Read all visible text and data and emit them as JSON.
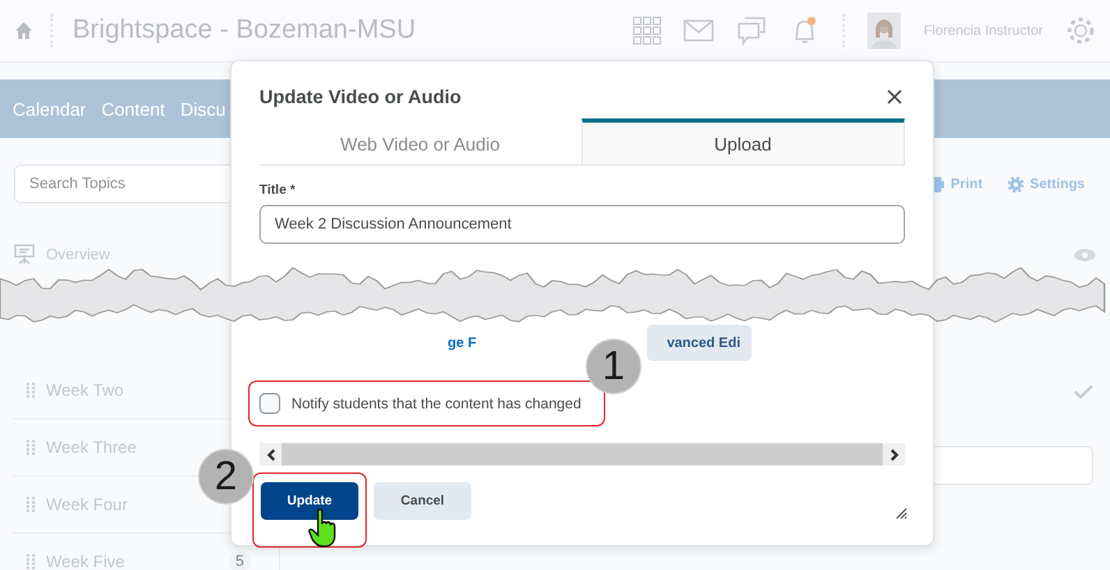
{
  "header": {
    "title": "Brightspace - Bozeman-MSU",
    "user_name": "Florencia Instructor"
  },
  "nav": {
    "items": [
      "Calendar",
      "Content",
      "Discu"
    ]
  },
  "toolbar": {
    "search": {
      "placeholder": "Search Topics"
    },
    "actions": [
      "Print",
      "Settings"
    ]
  },
  "sidebar": {
    "top_items": [
      {
        "label": "Overview"
      }
    ],
    "items": [
      {
        "label": "Week Two"
      },
      {
        "label": "Week Three"
      },
      {
        "label": "Week Four"
      },
      {
        "label": "Week Five",
        "count": "5"
      }
    ]
  },
  "dialog": {
    "title": "Update Video or Audio",
    "tabs": [
      {
        "label": "Web Video or Audio",
        "selected": false
      },
      {
        "label": "Upload",
        "selected": true
      }
    ],
    "title_field": {
      "label": "Title *",
      "value": "Week 2 Discussion Announcement"
    },
    "partial_link": "ge F",
    "partial_button": "vanced Edi",
    "notify": {
      "label": "Notify students that the content has changed",
      "checked": false
    },
    "buttons": [
      {
        "label": "Update",
        "kind": "primary"
      },
      {
        "label": "Cancel",
        "kind": "secondary"
      }
    ]
  },
  "callouts": [
    {
      "label": "1"
    },
    {
      "label": "2"
    }
  ]
}
